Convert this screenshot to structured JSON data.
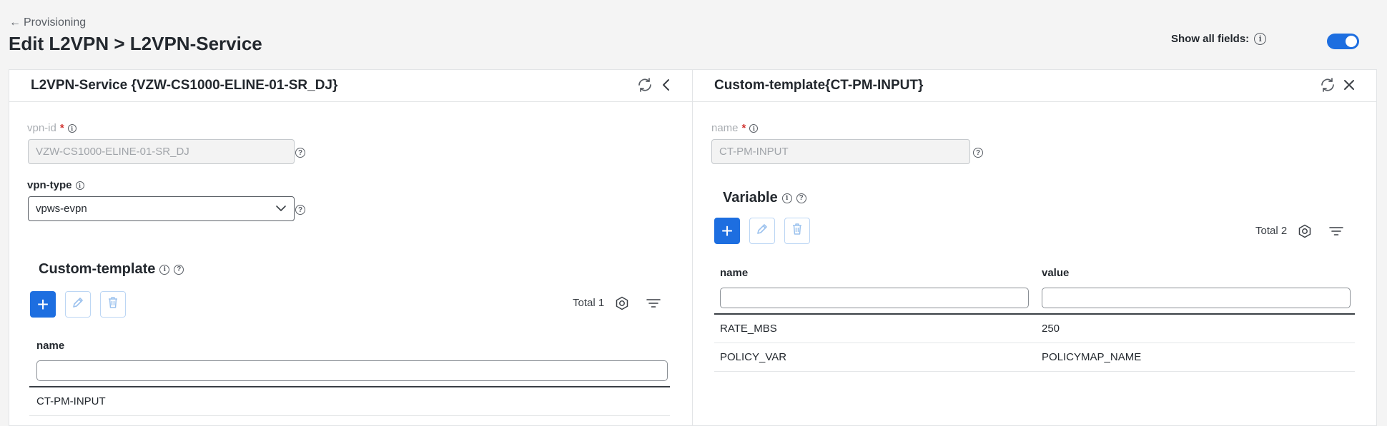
{
  "header": {
    "back_label": "Provisioning",
    "title": "Edit L2VPN > L2VPN-Service",
    "show_all_label": "Show all fields:",
    "show_all_enabled": true
  },
  "left_panel": {
    "title": "L2VPN-Service {VZW-CS1000-ELINE-01-SR_DJ}",
    "vpn_id": {
      "label": "vpn-id",
      "value": "VZW-CS1000-ELINE-01-SR_DJ"
    },
    "vpn_type": {
      "label": "vpn-type",
      "value": "vpws-evpn"
    },
    "section": {
      "title": "Custom-template",
      "total_label": "Total 1",
      "columns": [
        "name"
      ],
      "rows": [
        [
          "CT-PM-INPUT"
        ]
      ]
    }
  },
  "right_panel": {
    "title": "Custom-template{CT-PM-INPUT}",
    "name_field": {
      "label": "name",
      "value": "CT-PM-INPUT"
    },
    "section": {
      "title": "Variable",
      "total_label": "Total 2",
      "columns": [
        "name",
        "value"
      ],
      "rows": [
        [
          "RATE_MBS",
          "250"
        ],
        [
          "POLICY_VAR",
          "POLICYMAP_NAME"
        ]
      ]
    }
  },
  "colors": {
    "accent": "#1d6ee0",
    "required": "#d0312d"
  }
}
